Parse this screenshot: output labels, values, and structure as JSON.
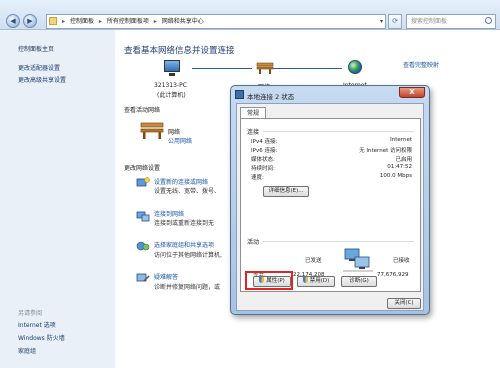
{
  "explorer": {
    "breadcrumb": [
      "控制面板",
      "所有控制面板项",
      "网络和共享中心"
    ],
    "search_placeholder": "搜索控制面板",
    "nav_back": "◀",
    "nav_fwd": "▶",
    "refresh": "⟳"
  },
  "left_pane": {
    "home": "控制面板主页",
    "links": [
      "更改适配器设置",
      "更改高级共享设置"
    ],
    "see_also_title": "另请参阅",
    "see_also": [
      "Internet 选项",
      "Windows 防火墙",
      "家庭组"
    ]
  },
  "main": {
    "title": "查看基本网络信息并设置连接",
    "full_map": "查看完整映射",
    "map": {
      "pc_name": "321313-PC",
      "pc_sub": "(此计算机)",
      "network_label": "网络",
      "internet_label": "Internet"
    },
    "active_section": "查看活动网络",
    "active_network": {
      "name": "网络",
      "type": "公用网络"
    },
    "change_section": "更改网络设置",
    "tasks": [
      {
        "title": "设置新的连接或网络",
        "desc": "设置无线、宽带、拨号、"
      },
      {
        "title": "连接到网络",
        "desc": "连接到或重新连接到无"
      },
      {
        "title": "选择家庭组和共享选项",
        "desc": "访问位于其他网络计算机,"
      },
      {
        "title": "疑难解答",
        "desc": "诊断并修复网络问题，或"
      }
    ]
  },
  "dialog": {
    "title": "本地连接 2 状态",
    "close": "X",
    "tab": "常规",
    "connection_group": "连接",
    "rows": [
      {
        "label": "IPv4 连接:",
        "value": "Internet"
      },
      {
        "label": "IPv6 连接:",
        "value": "无 Internet 访问权限"
      },
      {
        "label": "媒体状态:",
        "value": "已启用"
      },
      {
        "label": "持续时间:",
        "value": "01:47:52"
      },
      {
        "label": "速度:",
        "value": "100.0 Mbps"
      }
    ],
    "details_button": "详细信息(E)...",
    "activity_group": "活动",
    "sent_label": "已发送",
    "received_label": "已接收",
    "bytes_label": "字节:",
    "bytes_sent": "22,174,208",
    "bytes_received": "77,676,929",
    "properties_button": "属性(P)",
    "disable_button": "禁用(D)",
    "diagnose_button": "诊断(G)",
    "close_button": "关闭(C)"
  }
}
